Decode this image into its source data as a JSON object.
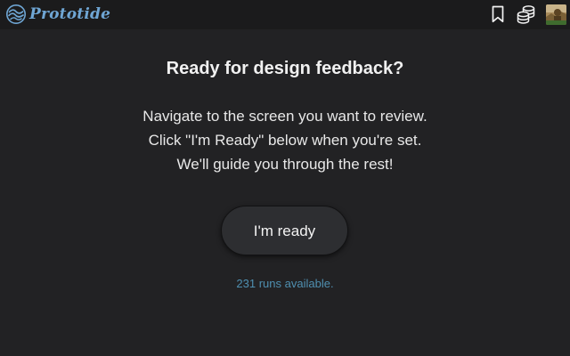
{
  "app": {
    "brand_name": "Prototide",
    "accent_color": "#6fa6d4"
  },
  "header": {
    "icons": [
      "wave-logo-icon",
      "bookmark-icon",
      "coins-stack-icon",
      "user-avatar"
    ]
  },
  "main": {
    "title": "Ready for design feedback?",
    "message_lines": [
      "Navigate to the screen you want to review.",
      "Click \"I'm Ready\" below when you're set.",
      "We'll guide you through the rest!"
    ],
    "ready_button_label": "I'm ready",
    "runs_text": "231 runs available.",
    "runs_color": "#4f8fb0"
  }
}
